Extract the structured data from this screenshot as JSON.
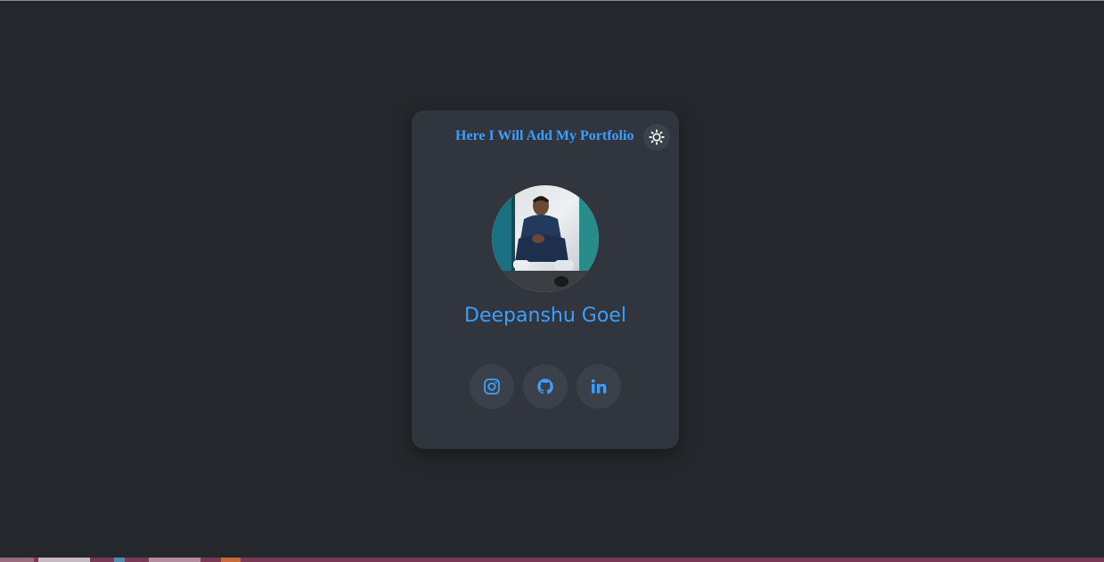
{
  "card": {
    "title": "Here I Will Add My Portfolio",
    "name": "Deepanshu Goel"
  },
  "theme_toggle": {
    "icon": "sun-icon"
  },
  "avatar": {
    "icon": "profile-photo"
  },
  "socials": [
    {
      "icon": "instagram-icon"
    },
    {
      "icon": "github-icon"
    },
    {
      "icon": "linkedin-icon"
    }
  ],
  "colors": {
    "background": "#24272b",
    "card": "#30353e",
    "accent": "#3d9eff",
    "button": "#3b414a"
  }
}
